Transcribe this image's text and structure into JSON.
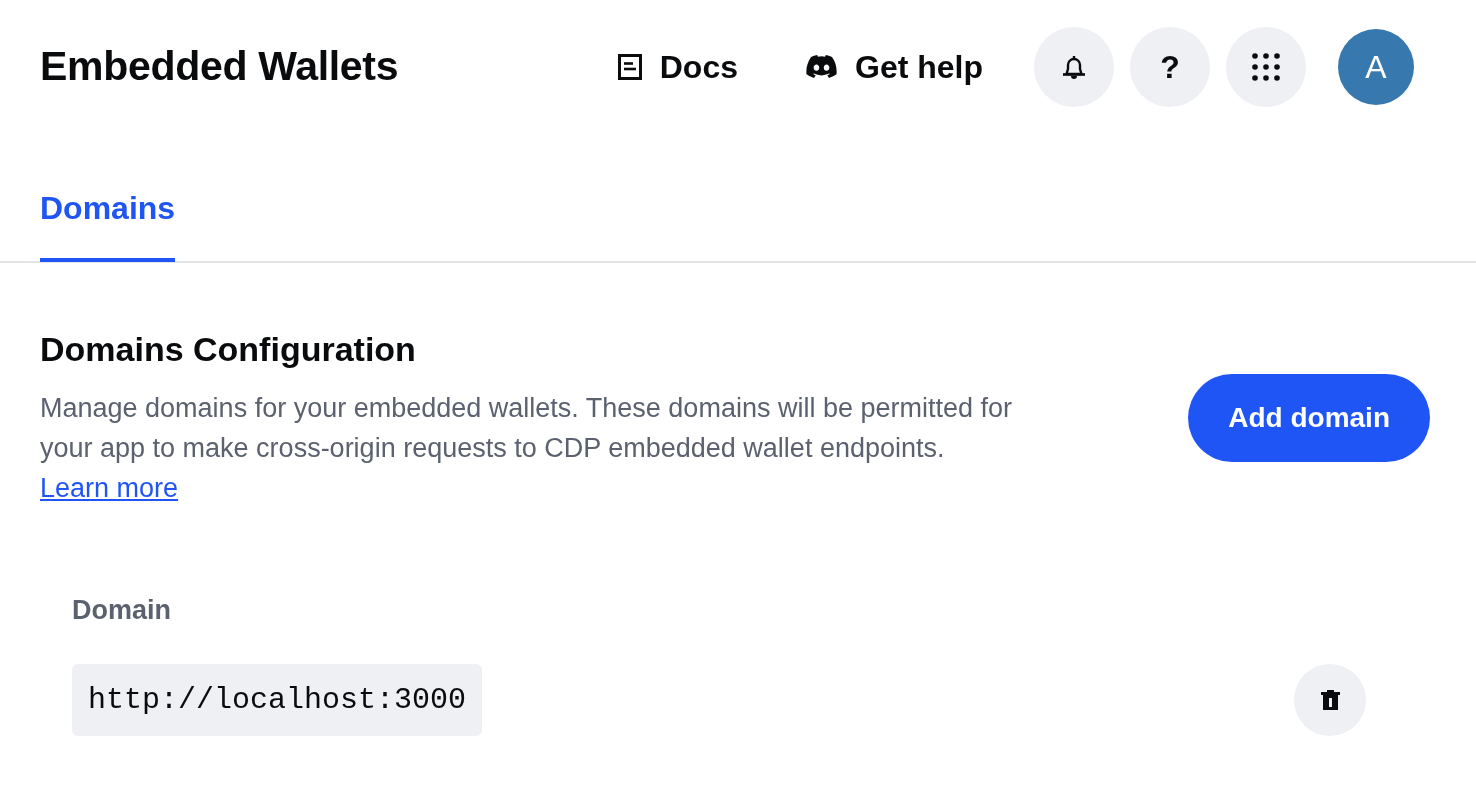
{
  "header": {
    "title": "Embedded Wallets",
    "links": [
      {
        "label": "Docs",
        "kind": "docs"
      },
      {
        "label": "Get help",
        "kind": "chat"
      }
    ],
    "help_button": {
      "label": "?"
    },
    "avatar": {
      "initial": "A"
    }
  },
  "tabs": [
    {
      "label": "Domains",
      "selected": true
    }
  ],
  "section": {
    "title": "Domains Configuration",
    "description": "Manage domains for your embedded wallets. These domains will be permitted for your app to make cross-origin requests to CDP embedded wallet endpoints.",
    "link": "Learn more",
    "button": "Add domain"
  },
  "table": {
    "columns": [
      "Domain"
    ],
    "rows": [
      {
        "domain": "http://localhost:3000"
      }
    ]
  }
}
